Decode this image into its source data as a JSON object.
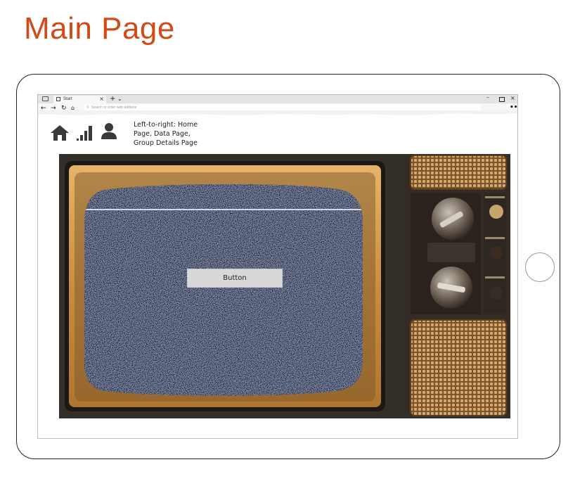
{
  "page": {
    "title": "Main Page"
  },
  "browser": {
    "tab_label": "Start",
    "address_placeholder": "Search or enter web address",
    "more_glyph": "•••"
  },
  "content": {
    "caption": "Left-to-right: Home Page, Data Page, Group Details Page",
    "button_label": "Button",
    "nav_icons": [
      "home-icon",
      "data-bars-icon",
      "user-icon"
    ]
  },
  "colors": {
    "title": "#d24a17",
    "button_bg": "#d8d8d8"
  }
}
